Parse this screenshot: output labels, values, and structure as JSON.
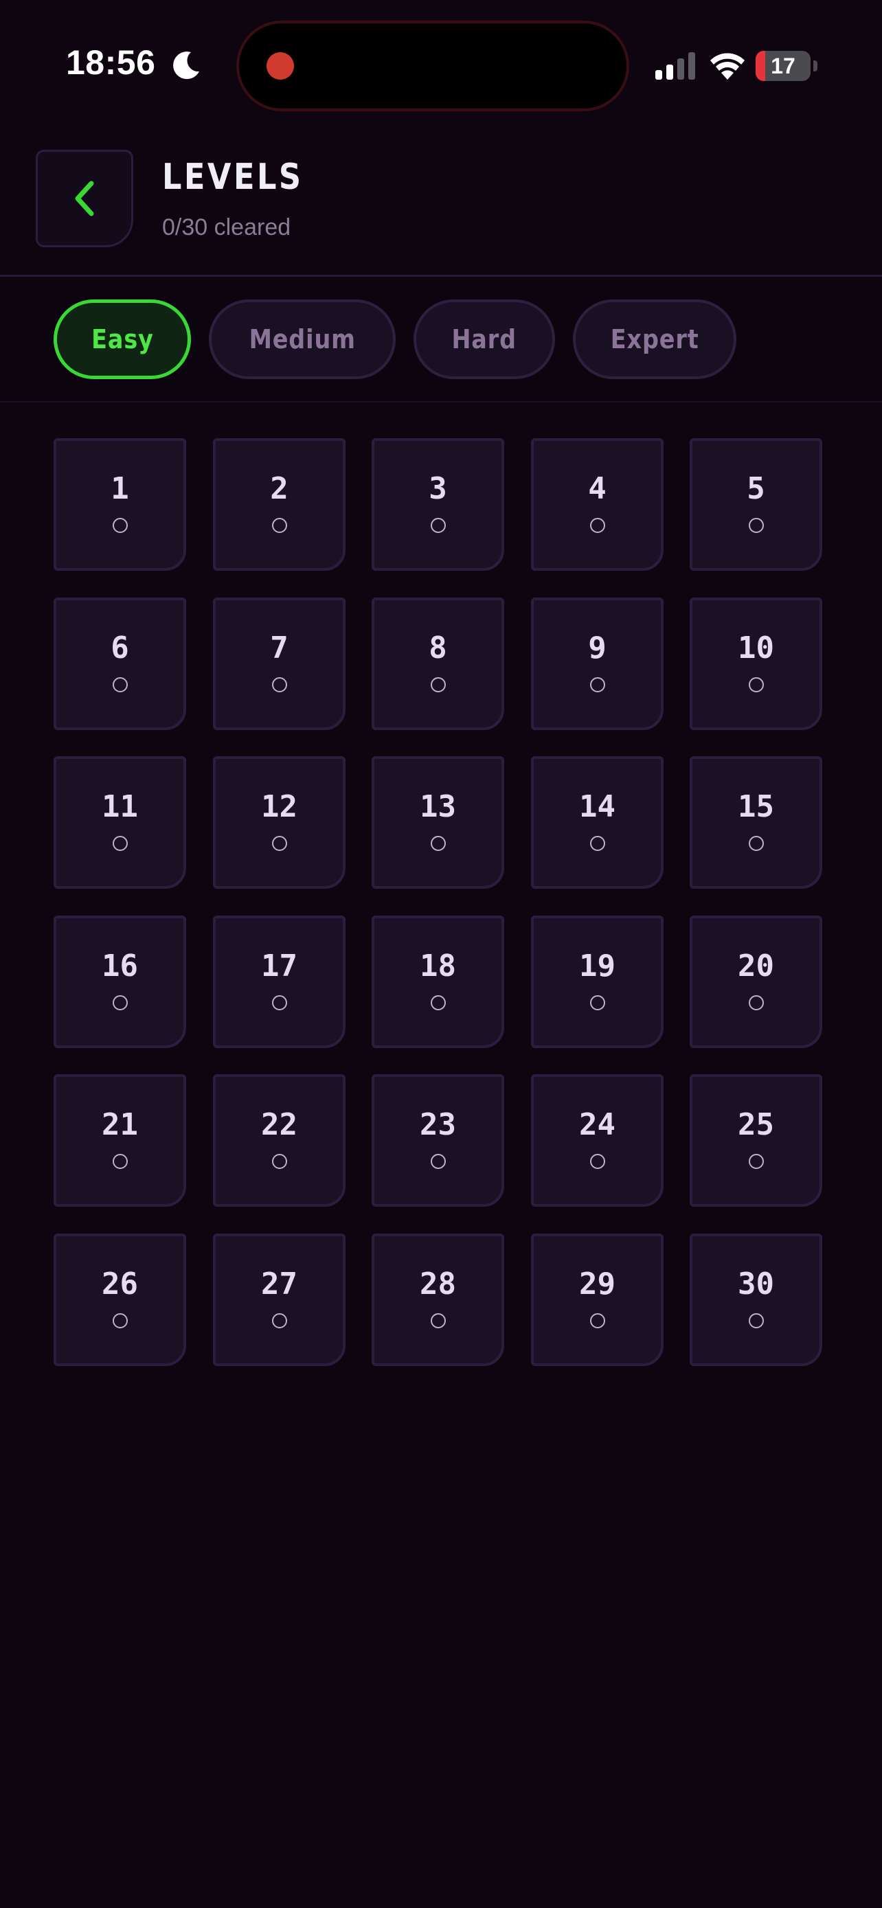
{
  "status_bar": {
    "time": "18:56",
    "battery_level": "17",
    "battery_fraction": 0.17,
    "battery_color": "#e5343c",
    "icons": [
      "moon-icon",
      "signal-icon",
      "wifi-icon",
      "battery-icon"
    ],
    "recording_indicator_color": "#d13b2f"
  },
  "header": {
    "title": "LEVELS",
    "progress": "0/30 cleared",
    "back_icon": "chevron-left-icon",
    "accent_color": "#39d834"
  },
  "tabs": [
    {
      "label": "Easy",
      "active": true
    },
    {
      "label": "Medium",
      "active": false
    },
    {
      "label": "Hard",
      "active": false
    },
    {
      "label": "Expert",
      "active": false
    }
  ],
  "levels": [
    {
      "number": "1",
      "cleared": false
    },
    {
      "number": "2",
      "cleared": false
    },
    {
      "number": "3",
      "cleared": false
    },
    {
      "number": "4",
      "cleared": false
    },
    {
      "number": "5",
      "cleared": false
    },
    {
      "number": "6",
      "cleared": false
    },
    {
      "number": "7",
      "cleared": false
    },
    {
      "number": "8",
      "cleared": false
    },
    {
      "number": "9",
      "cleared": false
    },
    {
      "number": "10",
      "cleared": false
    },
    {
      "number": "11",
      "cleared": false
    },
    {
      "number": "12",
      "cleared": false
    },
    {
      "number": "13",
      "cleared": false
    },
    {
      "number": "14",
      "cleared": false
    },
    {
      "number": "15",
      "cleared": false
    },
    {
      "number": "16",
      "cleared": false
    },
    {
      "number": "17",
      "cleared": false
    },
    {
      "number": "18",
      "cleared": false
    },
    {
      "number": "19",
      "cleared": false
    },
    {
      "number": "20",
      "cleared": false
    },
    {
      "number": "21",
      "cleared": false
    },
    {
      "number": "22",
      "cleared": false
    },
    {
      "number": "23",
      "cleared": false
    },
    {
      "number": "24",
      "cleared": false
    },
    {
      "number": "25",
      "cleared": false
    },
    {
      "number": "26",
      "cleared": false
    },
    {
      "number": "27",
      "cleared": false
    },
    {
      "number": "28",
      "cleared": false
    },
    {
      "number": "29",
      "cleared": false
    },
    {
      "number": "30",
      "cleared": false
    }
  ]
}
